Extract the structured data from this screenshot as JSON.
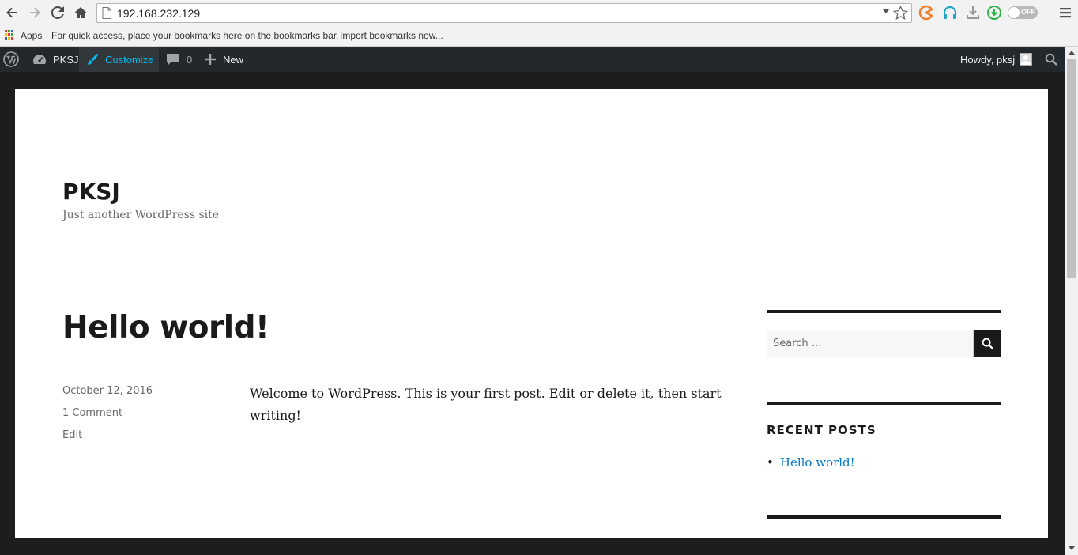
{
  "browser": {
    "url": "192.168.232.129",
    "toggle_label": "OFF",
    "bookmarks": {
      "apps_label": "Apps",
      "hint": "For quick access, place your bookmarks here on the bookmarks bar.",
      "import_link": "Import bookmarks now..."
    }
  },
  "adminbar": {
    "site_name": "PKSJ",
    "customize": "Customize",
    "comments_count": "0",
    "new": "New",
    "howdy": "Howdy, pksj"
  },
  "site": {
    "title": "PKSJ",
    "description": "Just another WordPress site"
  },
  "post": {
    "title": "Hello world!",
    "date": "October 12, 2016",
    "comments": "1 Comment",
    "edit": "Edit",
    "body": "Welcome to WordPress. This is your first post. Edit or delete it, then start writing!"
  },
  "sidebar": {
    "search_placeholder": "Search …",
    "recent_posts_title": "RECENT POSTS",
    "recent_posts": [
      "Hello world!"
    ]
  },
  "colors": {
    "adminbar_bg": "#23282d",
    "link": "#007acc",
    "customize_accent": "#00b9eb"
  }
}
